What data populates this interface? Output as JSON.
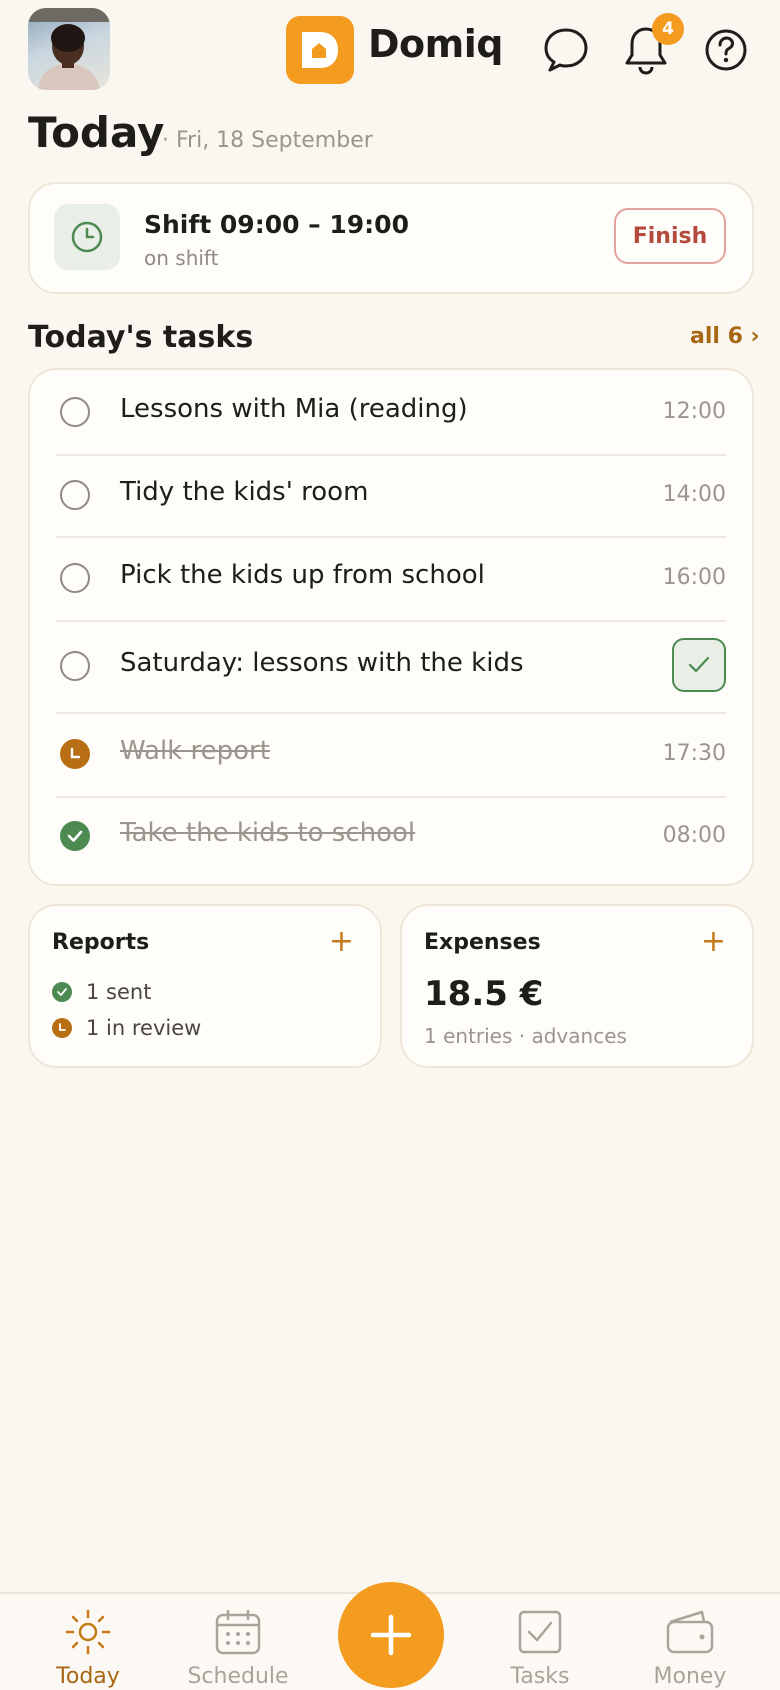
{
  "header": {
    "brand_name": "Domiq",
    "notification_count": "4",
    "icons": [
      "avatar",
      "logo-icon",
      "chat-icon",
      "bell-icon",
      "help-icon"
    ]
  },
  "page": {
    "title": "Today",
    "date": "· Fri, 18 September"
  },
  "shift": {
    "title": "Shift 09:00 – 19:00",
    "status": "on shift",
    "finish_label": "Finish"
  },
  "tasks": {
    "section_title": "Today's tasks",
    "all_link": "all 6 ›",
    "items": [
      {
        "text": "Lessons with Mia (reading)",
        "time": "12:00",
        "state": "open"
      },
      {
        "text": "Tidy the kids' room",
        "time": "14:00",
        "state": "open"
      },
      {
        "text": "Pick the kids up from school",
        "time": "16:00",
        "state": "open"
      },
      {
        "text": "Saturday: lessons with the kids",
        "time": "",
        "state": "open-confirm"
      },
      {
        "text": "Walk report",
        "time": "17:30",
        "state": "in-review"
      },
      {
        "text": "Take the kids to school",
        "time": "08:00",
        "state": "done"
      }
    ]
  },
  "reports": {
    "title": "Reports",
    "plus": "+",
    "sent": "1 sent",
    "in_review": "1 in review"
  },
  "expenses": {
    "title": "Expenses",
    "plus": "+",
    "amount": "18.5 €",
    "sub": "1 entries · advances"
  },
  "nav": {
    "items": [
      {
        "label": "Today",
        "icon": "sun-icon"
      },
      {
        "label": "Schedule",
        "icon": "calendar-icon"
      },
      {
        "label": "Tasks",
        "icon": "checkbox-icon"
      },
      {
        "label": "Money",
        "icon": "wallet-icon"
      }
    ],
    "fab_icon": "plus-icon"
  },
  "colors": {
    "accent": "#f39c1f",
    "accent_text": "#a86712",
    "success": "#4c8a52",
    "review": "#b86f14",
    "danger": "#b34a3c",
    "background": "#faf6f0"
  }
}
